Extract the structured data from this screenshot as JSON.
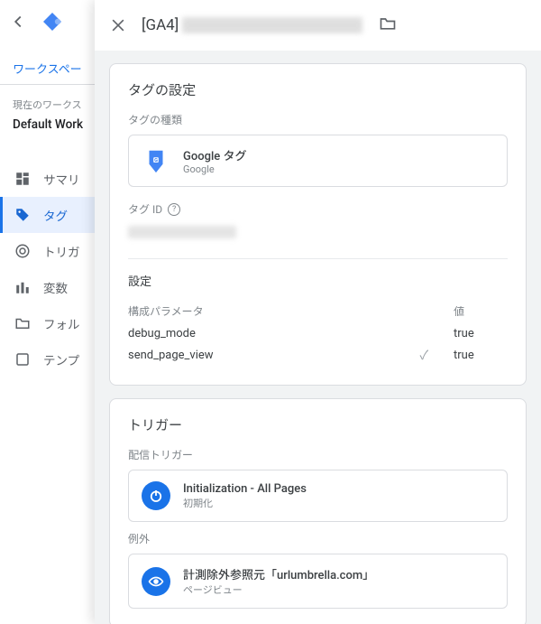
{
  "sidebar": {
    "tab_label": "ワークスペー",
    "current_ws_label": "現在のワークス",
    "workspace_name": "Default Work",
    "nav": [
      {
        "icon": "dashboard-icon",
        "label": "サマリ"
      },
      {
        "icon": "tag-icon",
        "label": "タグ"
      },
      {
        "icon": "trigger-icon",
        "label": "トリガ"
      },
      {
        "icon": "variable-icon",
        "label": "変数"
      },
      {
        "icon": "folder-icon",
        "label": "フォル"
      },
      {
        "icon": "template-icon",
        "label": "テンプ"
      }
    ]
  },
  "header": {
    "title_prefix": "[GA4]"
  },
  "tag_config": {
    "heading": "タグの設定",
    "type_label": "タグの種類",
    "type_name": "Google タグ",
    "type_vendor": "Google",
    "tag_id_label": "タグ ID",
    "settings_label": "設定",
    "param_col_key": "構成パラメータ",
    "param_col_val": "値",
    "params": [
      {
        "key": "debug_mode",
        "value": "true",
        "checked": false
      },
      {
        "key": "send_page_view",
        "value": "true",
        "checked": true
      }
    ]
  },
  "triggers": {
    "heading": "トリガー",
    "fire_label": "配信トリガー",
    "fire": {
      "name": "Initialization - All Pages",
      "kind": "初期化"
    },
    "except_label": "例外",
    "except": {
      "name": "計測除外参照元「urlumbrella.com」",
      "kind": "ページビュー"
    }
  }
}
